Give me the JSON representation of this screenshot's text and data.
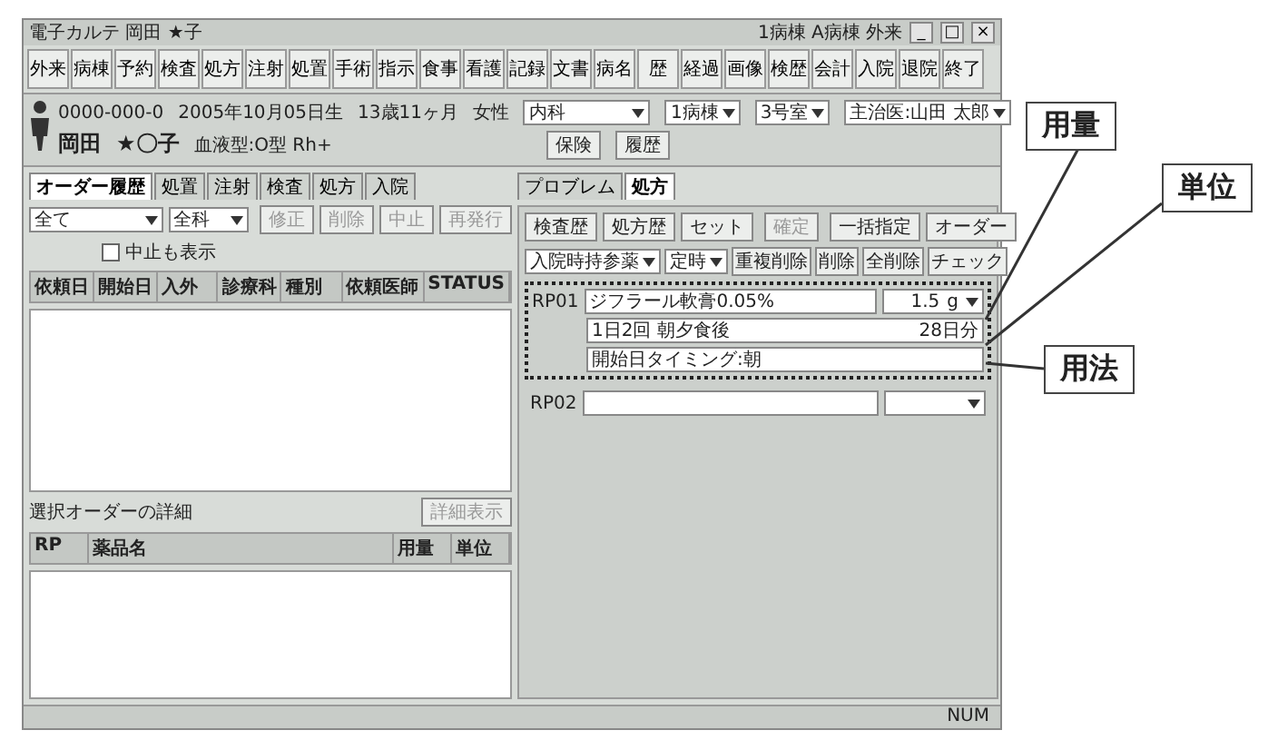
{
  "window": {
    "title": "電子カルテ 岡田 ★子",
    "controls": [
      "_",
      "□",
      "×"
    ],
    "status_right": "1病棟 A病棟 外来"
  },
  "toolbar": [
    {
      "label": "外来"
    },
    {
      "label": "病棟"
    },
    {
      "label": "予約"
    },
    {
      "label": "検査"
    },
    {
      "label": "処方"
    },
    {
      "label": "注射"
    },
    {
      "label": "処置"
    },
    {
      "label": "手術"
    },
    {
      "label": "指示"
    },
    {
      "label": "食事"
    },
    {
      "label": "看護"
    },
    {
      "label": "記録"
    },
    {
      "label": "文書"
    },
    {
      "label": "病名"
    },
    {
      "label": "歴"
    },
    {
      "label": "経過"
    },
    {
      "label": "画像"
    },
    {
      "label": "検歴"
    },
    {
      "label": "会計"
    },
    {
      "label": "入院"
    },
    {
      "label": "退院"
    },
    {
      "label": "終了"
    }
  ],
  "patient": {
    "id": "0000-000-0",
    "birth": "2005年10月05日生",
    "age": "13歳11ヶ月",
    "sex": "女性",
    "family_name": "岡田",
    "given_name": "★〇子",
    "blood": "血液型:O型 Rh+",
    "dept": "内科",
    "ward": "1病棟",
    "room": "3号室",
    "doctor": "主治医:山田 太郎",
    "buttons": [
      "保険",
      "履歴"
    ]
  },
  "left": {
    "tabs": [
      {
        "label": "オーダー履歴",
        "selected": true
      },
      {
        "label": "処置",
        "selected": false
      },
      {
        "label": "注射",
        "selected": false
      },
      {
        "label": "検査",
        "selected": false
      },
      {
        "label": "処方",
        "selected": false
      },
      {
        "label": "入院",
        "selected": false
      }
    ],
    "filters": [
      "全て",
      "全科"
    ],
    "show_cancelled": {
      "label": "中止も表示",
      "checked": false
    },
    "actions": [
      {
        "label": "修正",
        "disabled": true
      },
      {
        "label": "削除",
        "disabled": true
      },
      {
        "label": "中止",
        "disabled": true
      },
      {
        "label": "再発行",
        "disabled": true
      }
    ],
    "columns": [
      "依頼日",
      "開始日",
      "入外",
      "診療科",
      "種別",
      "依頼医師",
      "STATUS"
    ],
    "detail_title": "選択オーダーの詳細",
    "detail_button": {
      "label": "詳細表示",
      "disabled": true
    },
    "detail_columns": [
      "RP",
      "薬品名",
      "用量",
      "単位"
    ]
  },
  "right": {
    "tabs": [
      {
        "label": "プロブレム",
        "selected": false
      },
      {
        "label": "処方",
        "selected": true
      }
    ],
    "buttons": [
      {
        "label": "検査歴",
        "disabled": false
      },
      {
        "label": "処方歴",
        "disabled": false
      },
      {
        "label": "セット",
        "disabled": false
      },
      {
        "label": "確定",
        "disabled": true
      },
      {
        "label": "一括指定",
        "disabled": false
      },
      {
        "label": "オーダー",
        "disabled": false
      }
    ],
    "selects": [
      "入院時持参薬",
      "定時"
    ],
    "row_buttons": [
      "重複削除",
      "削除",
      "全削除",
      "チェック"
    ],
    "rps": [
      {
        "label": "RP01",
        "drug": "ジフラール軟膏0.05%",
        "amount": "1.5",
        "unit": "g",
        "usage": "1日2回 朝夕食後",
        "days": "28日分",
        "timing": "開始日タイミング:朝"
      },
      {
        "label": "RP02"
      }
    ]
  },
  "status_bar": "NUM",
  "callouts": [
    "用量",
    "単位",
    "用法"
  ]
}
